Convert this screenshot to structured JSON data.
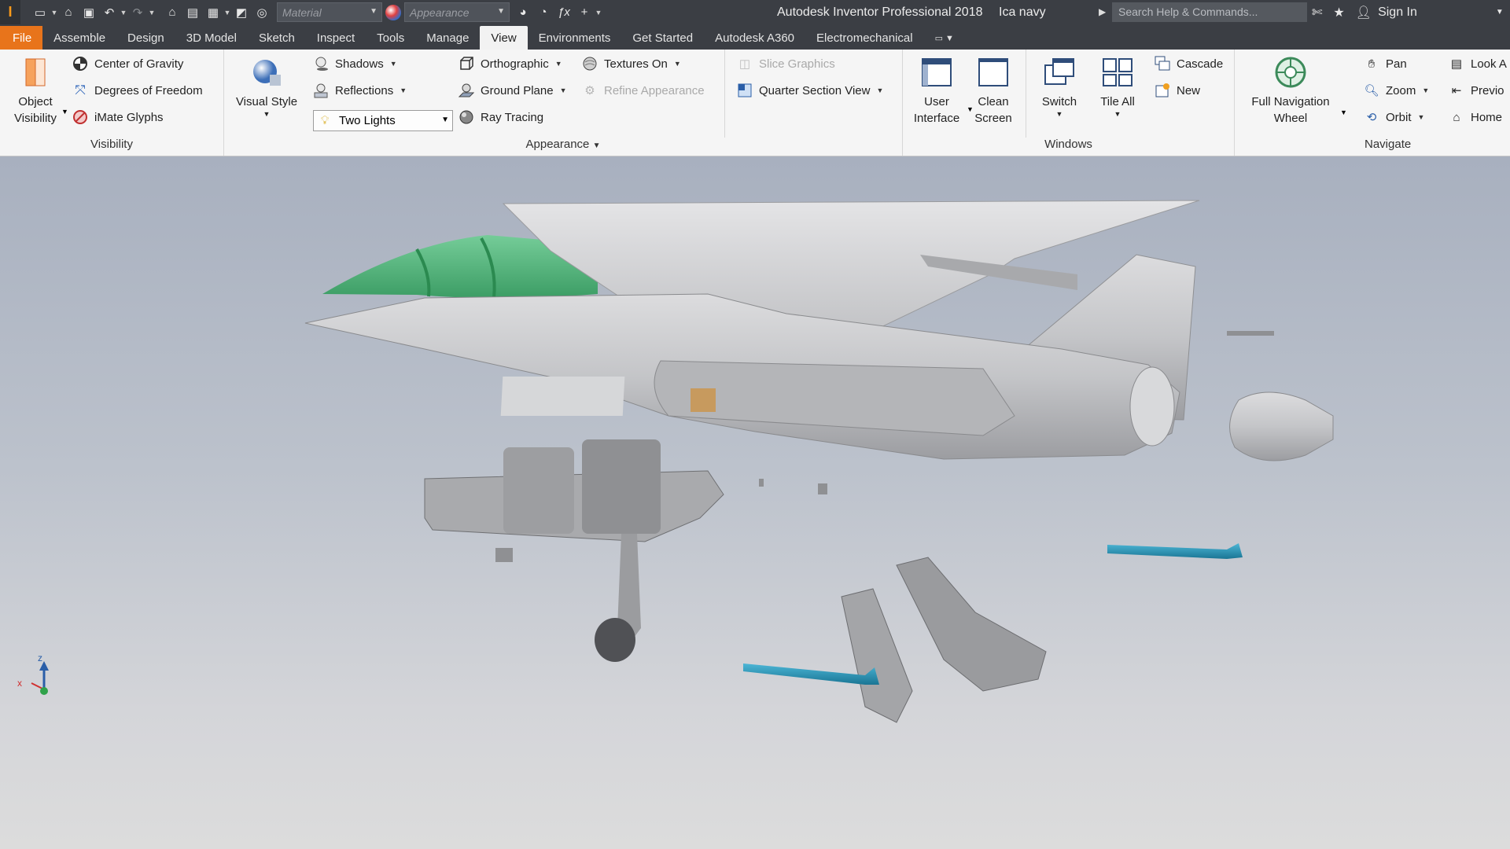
{
  "titlebar": {
    "app_title": "Autodesk Inventor Professional 2018",
    "document": "Ica navy",
    "material_placeholder": "Material",
    "appearance_placeholder": "Appearance",
    "search_placeholder": "Search Help & Commands...",
    "sign_in": "Sign In",
    "logo_text": "I"
  },
  "tabs": [
    "File",
    "Assemble",
    "Design",
    "3D Model",
    "Sketch",
    "Inspect",
    "Tools",
    "Manage",
    "View",
    "Environments",
    "Get Started",
    "Autodesk A360",
    "Electromechanical"
  ],
  "ribbon": {
    "visibility": {
      "title": "Visibility",
      "object_visibility_1": "Object",
      "object_visibility_2": "Visibility",
      "center_of_gravity": "Center of Gravity",
      "degrees_of_freedom": "Degrees of Freedom",
      "imate_glyphs": "iMate Glyphs"
    },
    "appearance": {
      "title": "Appearance",
      "visual_style": "Visual Style",
      "shadows": "Shadows",
      "reflections": "Reflections",
      "lighting": "Two Lights",
      "orthographic": "Orthographic",
      "ground_plane": "Ground Plane",
      "ray_tracing": "Ray Tracing",
      "textures_on": "Textures On",
      "refine_appearance": "Refine Appearance"
    },
    "section": {
      "slice_graphics": "Slice Graphics",
      "quarter_section_view": "Quarter Section View"
    },
    "windows": {
      "title": "Windows",
      "user_interface_1": "User",
      "user_interface_2": "Interface",
      "clean_screen_1": "Clean",
      "clean_screen_2": "Screen",
      "switch": "Switch",
      "tile_all": "Tile All",
      "cascade": "Cascade",
      "new": "New"
    },
    "navigate": {
      "title": "Navigate",
      "full_nav_1": "Full Navigation",
      "full_nav_2": "Wheel",
      "pan": "Pan",
      "zoom": "Zoom",
      "orbit": "Orbit",
      "look_at": "Look A",
      "previous": "Previo",
      "home": "Home"
    }
  },
  "viewcube": {
    "x": "x",
    "z": "z"
  },
  "colors": {
    "accent": "#e8741b",
    "canopy": "#3fae6a",
    "missile": "#1f8fb0",
    "body": "#c6c7c9"
  }
}
